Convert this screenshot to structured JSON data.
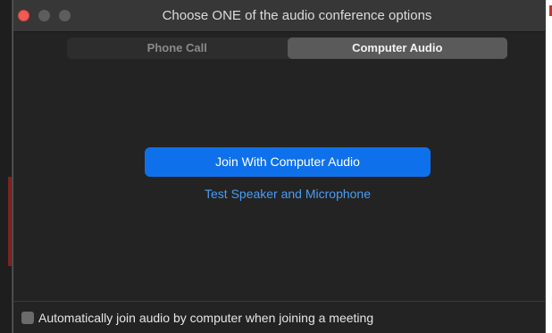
{
  "window": {
    "title": "Choose ONE of the audio conference options"
  },
  "tabs": [
    {
      "label": "Phone Call",
      "active": false
    },
    {
      "label": "Computer Audio",
      "active": true
    }
  ],
  "main": {
    "join_button_label": "Join With Computer Audio",
    "test_link_label": "Test Speaker and Microphone"
  },
  "footer": {
    "auto_join_label": "Automatically join audio by computer when joining a meeting",
    "auto_join_checked": false
  },
  "colors": {
    "accent": "#0e71eb",
    "link": "#4a9cf5",
    "window_bg": "#232323",
    "close_button": "#ee5b55"
  }
}
